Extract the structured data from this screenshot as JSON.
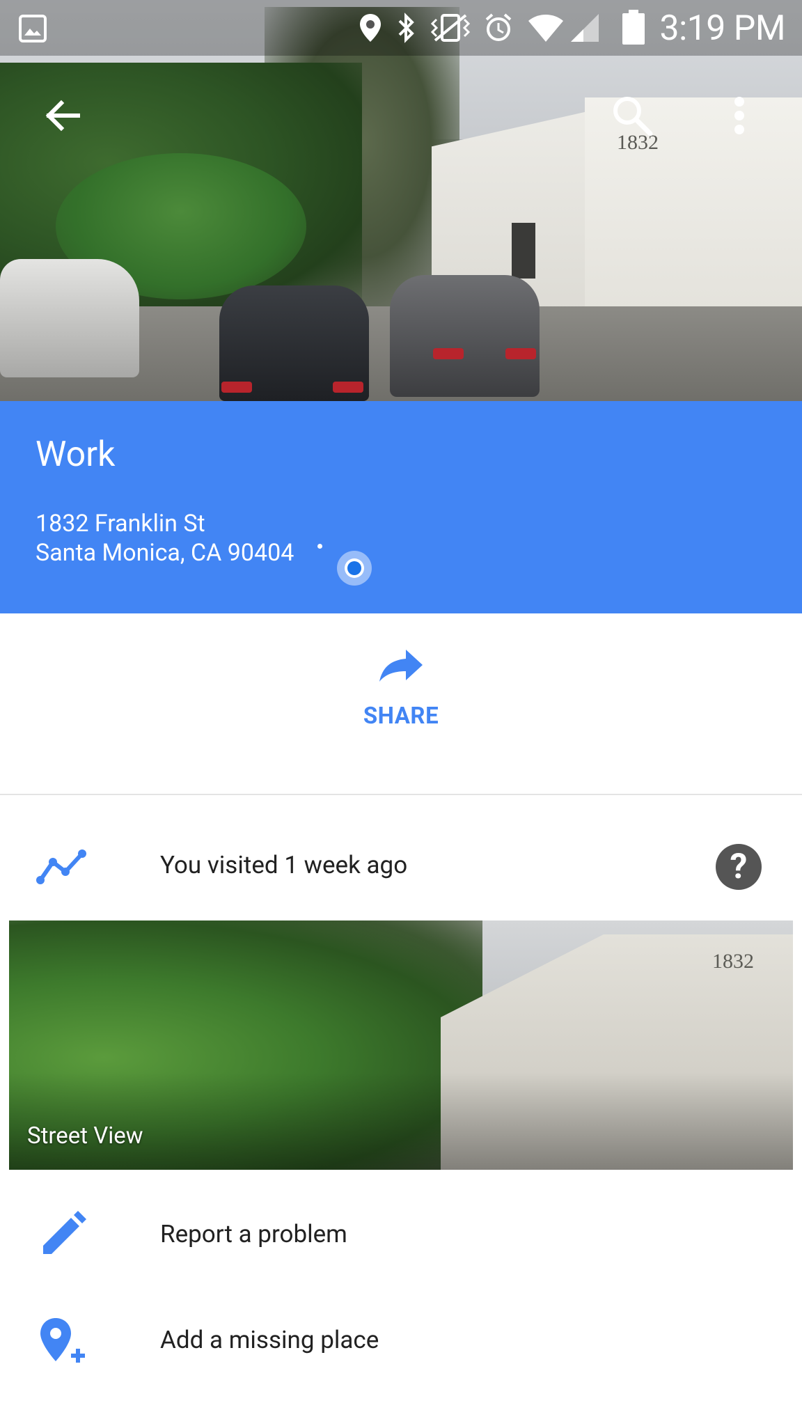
{
  "status_bar": {
    "time": "3:19 PM",
    "icons": [
      "gallery-icon",
      "location-icon",
      "bluetooth-icon",
      "vibrate-icon",
      "alarm-icon",
      "wifi-icon",
      "signal-icon",
      "battery-icon"
    ]
  },
  "app_bar": {
    "back_icon": "arrow-back-icon",
    "search_icon": "search-icon",
    "menu_icon": "more-vert-icon"
  },
  "hero": {
    "building_number": "1832"
  },
  "place": {
    "name": "Work",
    "address_line1": "1832 Franklin St",
    "address_line2": "Santa Monica, CA 90404"
  },
  "share": {
    "label": "SHARE",
    "icon": "share-arrow-icon"
  },
  "visited": {
    "text": "You visited 1 week ago",
    "help": "?"
  },
  "street_view": {
    "label": "Street View",
    "building_number": "1832"
  },
  "actions": [
    {
      "label": "Report a problem",
      "icon": "pencil-icon"
    },
    {
      "label": "Add a missing place",
      "icon": "add-location-icon"
    }
  ],
  "colors": {
    "accent": "#4285f4",
    "text": "#212121",
    "divider": "#e4e4e4"
  }
}
